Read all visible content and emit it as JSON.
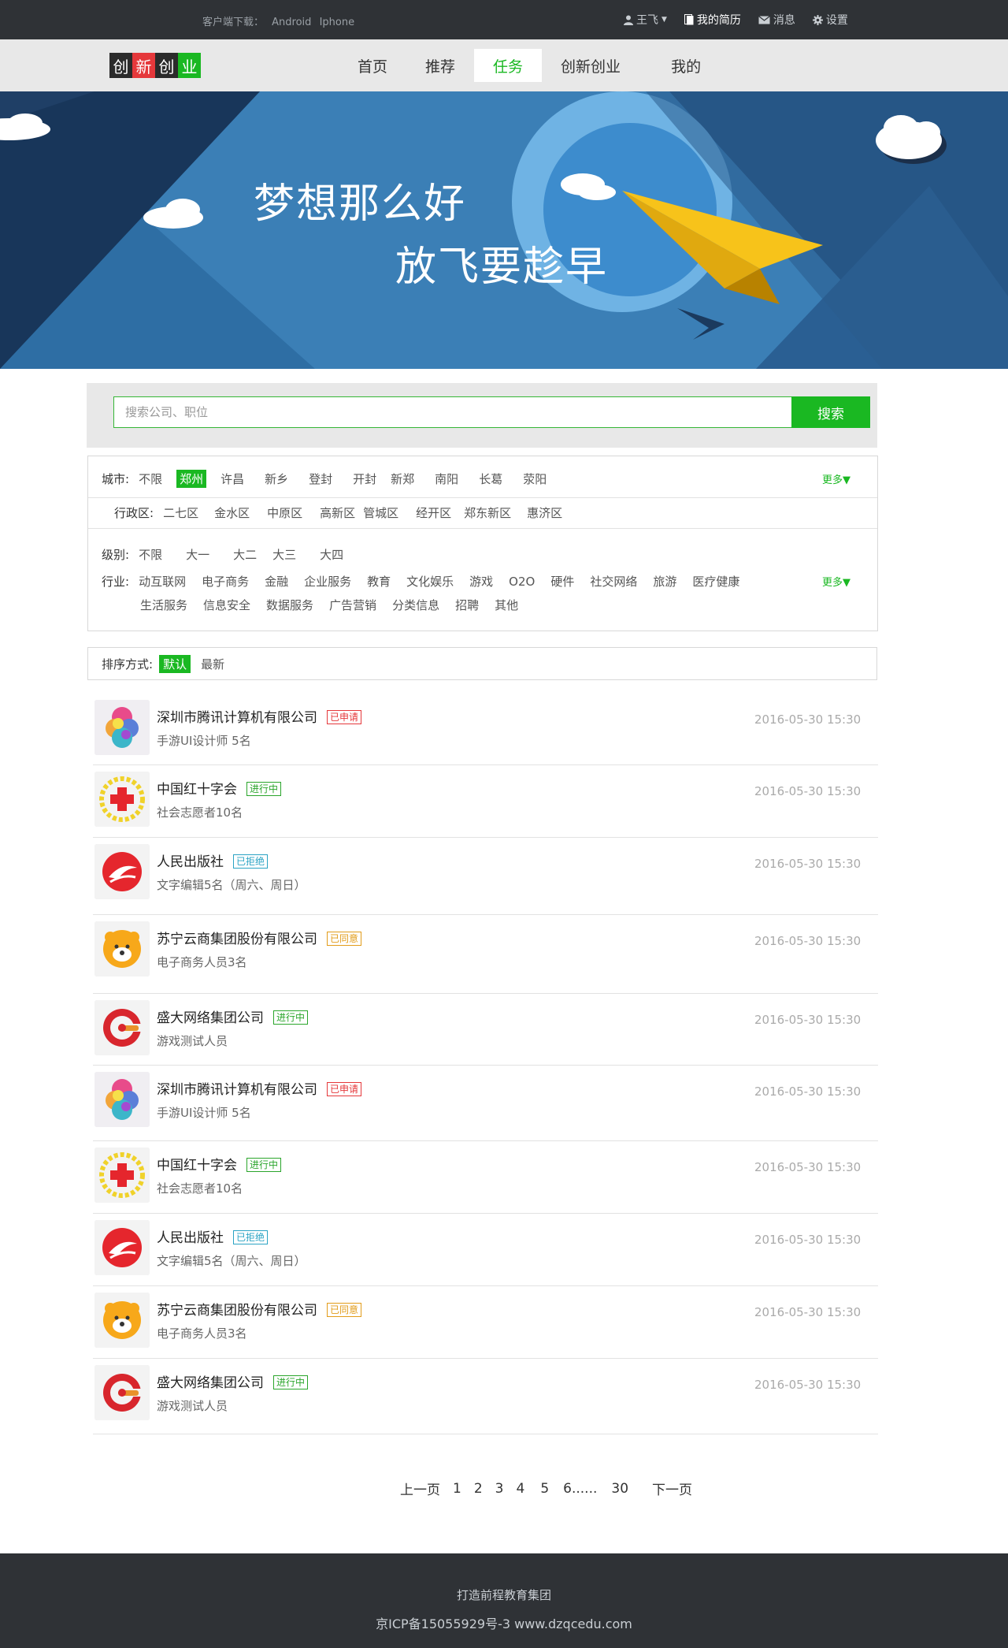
{
  "topbar": {
    "download_label": "客户端下载：",
    "android": "Android",
    "iphone": "Iphone",
    "user": "王飞",
    "resume": "我的简历",
    "messages": "消息",
    "settings": "设置"
  },
  "nav": {
    "logo_chars": [
      "创",
      "新",
      "创",
      "业"
    ],
    "items": [
      "首页",
      "推荐",
      "任务",
      "创新创业",
      "我的"
    ],
    "active": "任务"
  },
  "banner": {
    "line1": "梦想那么好",
    "line2": "放飞要趁早"
  },
  "search": {
    "placeholder": "搜索公司、职位",
    "button": "搜索"
  },
  "filters": {
    "city_label": "城市:",
    "cities": [
      "不限",
      "郑州",
      "许昌",
      "新乡",
      "登封",
      "开封",
      "新郑",
      "南阳",
      "长葛",
      "荥阳"
    ],
    "city_selected": "郑州",
    "more1": "更多▼",
    "district_label": "行政区:",
    "districts": [
      "二七区",
      "金水区",
      "中原区",
      "高新区",
      "管城区",
      "经开区",
      "郑东新区",
      "惠济区"
    ],
    "level_label": "级别:",
    "levels": [
      "不限",
      "大一",
      "大二",
      "大三",
      "大四"
    ],
    "industry_label": "行业:",
    "industries_row1": [
      "动互联网",
      "电子商务",
      "金融",
      "企业服务",
      "教育",
      "文化娱乐",
      "游戏",
      "O2O",
      "硬件",
      "社交网络",
      "旅游",
      "医疗健康"
    ],
    "industries_row2": [
      "生活服务",
      "信息安全",
      "数据服务",
      "广告营销",
      "分类信息",
      "招聘",
      "其他"
    ],
    "more2": "更多▼"
  },
  "sort": {
    "label": "排序方式:",
    "options": [
      "默认",
      "最新"
    ],
    "selected": "默认"
  },
  "jobs": [
    {
      "company": "深圳市腾讯计算机有限公司",
      "status": "已申请",
      "status_color": "red",
      "desc": "手游UI设计师 5名",
      "time": "2016-05-30 15:30",
      "logo": "tencent-logo"
    },
    {
      "company": "中国红十字会",
      "status": "进行中",
      "status_color": "green",
      "desc": "社会志愿者10名",
      "time": "2016-05-30 15:30",
      "logo": "redcross-logo"
    },
    {
      "company": "人民出版社",
      "status": "已拒绝",
      "status_color": "blue",
      "desc": "文字编辑5名（周六、周日）",
      "time": "2016-05-30 15:30",
      "logo": "publisher-logo"
    },
    {
      "company": "苏宁云商集团股份有限公司",
      "status": "已同意",
      "status_color": "orange",
      "desc": "电子商务人员3名",
      "time": "2016-05-30 15:30",
      "logo": "suning-logo"
    },
    {
      "company": "盛大网络集团公司",
      "status": "进行中",
      "status_color": "green",
      "desc": "游戏测试人员",
      "time": "2016-05-30 15:30",
      "logo": "shanda-logo"
    },
    {
      "company": "深圳市腾讯计算机有限公司",
      "status": "已申请",
      "status_color": "red",
      "desc": "手游UI设计师 5名",
      "time": "2016-05-30 15:30",
      "logo": "tencent-logo"
    },
    {
      "company": "中国红十字会",
      "status": "进行中",
      "status_color": "green",
      "desc": "社会志愿者10名",
      "time": "2016-05-30 15:30",
      "logo": "redcross-logo"
    },
    {
      "company": "人民出版社",
      "status": "已拒绝",
      "status_color": "blue",
      "desc": "文字编辑5名（周六、周日）",
      "time": "2016-05-30 15:30",
      "logo": "publisher-logo"
    },
    {
      "company": "苏宁云商集团股份有限公司",
      "status": "已同意",
      "status_color": "orange",
      "desc": "电子商务人员3名",
      "time": "2016-05-30 15:30",
      "logo": "suning-logo"
    },
    {
      "company": "盛大网络集团公司",
      "status": "进行中",
      "status_color": "green",
      "desc": "游戏测试人员",
      "time": "2016-05-30 15:30",
      "logo": "shanda-logo"
    }
  ],
  "pager": {
    "prev": "上一页",
    "pages": [
      "1",
      "2",
      "3",
      "4",
      "5",
      "6......",
      "30"
    ],
    "next": "下一页"
  },
  "footer": {
    "line1": "打造前程教育集团",
    "line2": "京ICP备15055929号-3   www.dzqcedu.com"
  }
}
